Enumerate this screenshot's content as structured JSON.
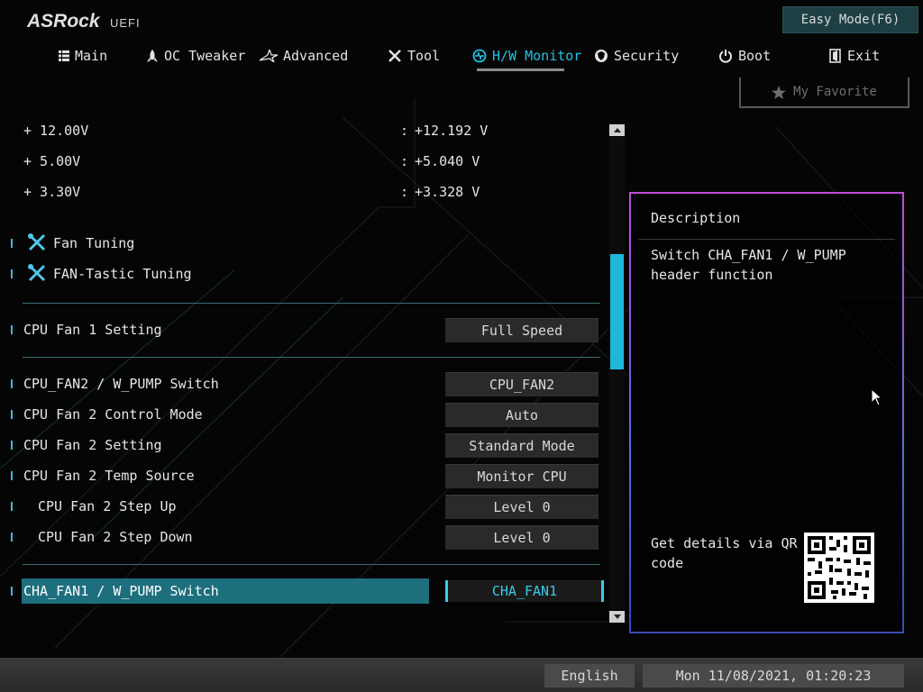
{
  "header": {
    "brand": "ASRock",
    "brand_sub": "UEFI",
    "easy_mode_label": "Easy Mode(F6)"
  },
  "nav": {
    "tabs": [
      {
        "label": "Main",
        "icon": "list-icon"
      },
      {
        "label": "OC Tweaker",
        "icon": "rocket-icon"
      },
      {
        "label": "Advanced",
        "icon": "star-icon"
      },
      {
        "label": "Tool",
        "icon": "tools-icon"
      },
      {
        "label": "H/W Monitor",
        "icon": "monitor-icon",
        "active": true
      },
      {
        "label": "Security",
        "icon": "shield-icon"
      },
      {
        "label": "Boot",
        "icon": "power-icon"
      },
      {
        "label": "Exit",
        "icon": "exit-icon"
      }
    ]
  },
  "favorite": {
    "label": "My Favorite"
  },
  "voltages": [
    {
      "label": "+ 12.00V",
      "colon": ":",
      "value": "+12.192 V"
    },
    {
      "label": "+ 5.00V",
      "colon": ":",
      "value": "+5.040 V"
    },
    {
      "label": "+ 3.30V",
      "colon": ":",
      "value": "+3.328 V"
    }
  ],
  "tuning": [
    {
      "label": "Fan Tuning"
    },
    {
      "label": "FAN-Tastic Tuning"
    }
  ],
  "settings": {
    "cpu_fan1": {
      "label": "CPU Fan 1 Setting",
      "value": "Full Speed"
    },
    "cpu_fan2_switch": {
      "label": "CPU_FAN2 / W_PUMP Switch",
      "value": "CPU_FAN2"
    },
    "cpu_fan2_mode": {
      "label": "CPU Fan 2 Control Mode",
      "value": "Auto"
    },
    "cpu_fan2_setting": {
      "label": "CPU Fan 2 Setting",
      "value": "Standard Mode"
    },
    "cpu_fan2_temp": {
      "label": "CPU Fan 2 Temp Source",
      "value": "Monitor CPU"
    },
    "cpu_fan2_stepup": {
      "label": "CPU Fan 2 Step Up",
      "value": "Level 0"
    },
    "cpu_fan2_stepdown": {
      "label": "CPU Fan 2 Step Down",
      "value": "Level 0"
    },
    "cha_fan1_switch": {
      "label": "CHA_FAN1 / W_PUMP Switch",
      "value": "CHA_FAN1"
    }
  },
  "description": {
    "title": "Description",
    "text": "Switch CHA_FAN1 / W_PUMP header function",
    "qr_text": "Get details via QR code"
  },
  "footer": {
    "language": "English",
    "datetime": "Mon 11/08/2021, 01:20:23"
  },
  "colors": {
    "accent": "#21c3e6",
    "selected_row": "#1e6f7e",
    "panel_border": "#c24ad9"
  }
}
